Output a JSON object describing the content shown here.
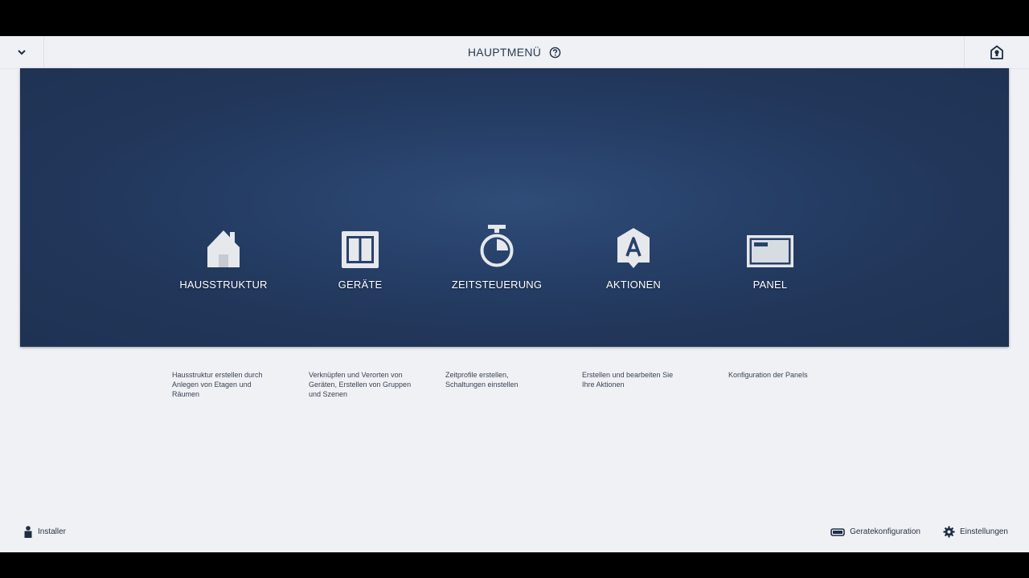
{
  "header": {
    "title": "HAUPTMENÜ",
    "menu_icon": "chevron-down-icon",
    "help_icon": "help-circle-icon",
    "home_icon": "home-lock-icon"
  },
  "tiles": [
    {
      "label": "HAUSSTRUKTUR",
      "icon": "house-icon",
      "description": "Hausstruktur erstellen durch Anlegen von Etagen und Räumen"
    },
    {
      "label": "GERÄTE",
      "icon": "device-icon",
      "description": "Verknüpfen und Verorten von Geräten, Erstellen von Gruppen und Szenen"
    },
    {
      "label": "ZEITSTEUERUNG",
      "icon": "stopwatch-icon",
      "description": "Zeitprofile erstellen, Schaltungen einstellen"
    },
    {
      "label": "AKTIONEN",
      "icon": "action-a-icon",
      "description": "Erstellen und bearbeiten Sie Ihre Aktionen"
    },
    {
      "label": "PANEL",
      "icon": "panel-icon",
      "description": "Konfiguration der Panels"
    }
  ],
  "footer": {
    "user_label": "Installer",
    "device_config_label": "Geratekonfiguration",
    "settings_label": "Einstellungen"
  },
  "colors": {
    "banner": "#213659",
    "background": "#eff1f5",
    "text_dark": "#2a3a52"
  }
}
